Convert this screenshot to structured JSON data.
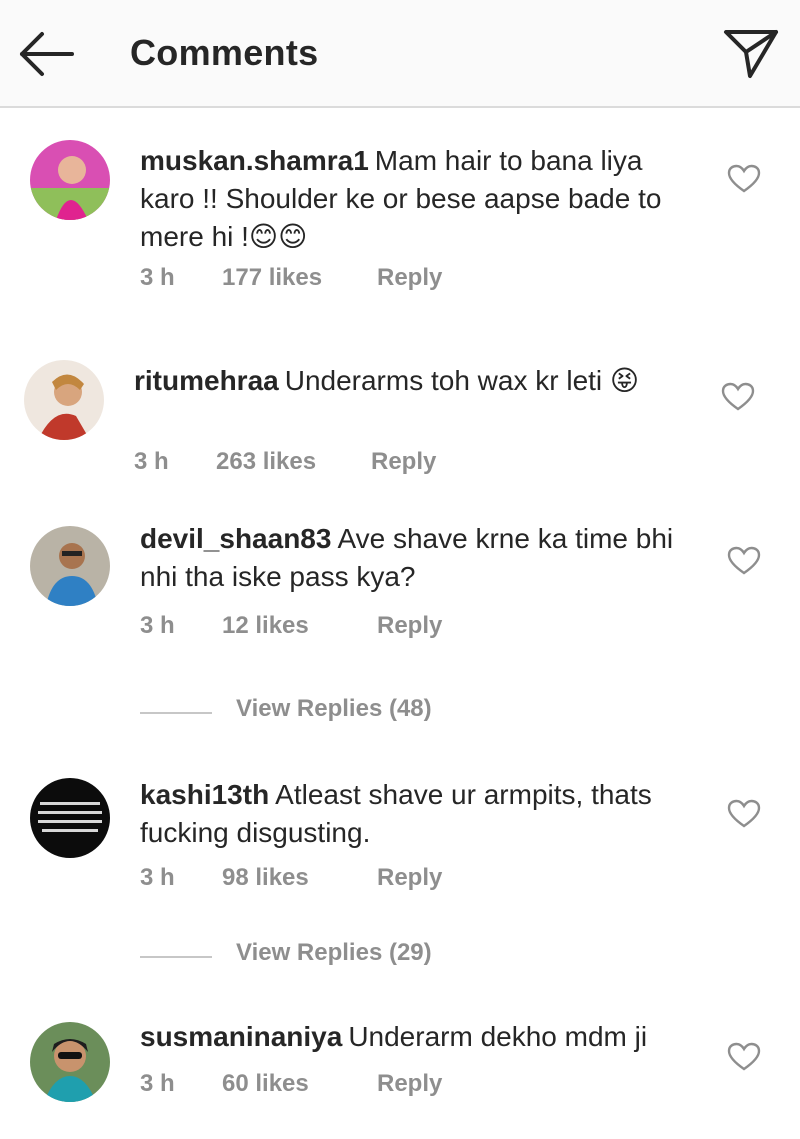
{
  "header": {
    "title": "Comments",
    "back_icon": "arrow-left-icon",
    "send_icon": "paper-plane-icon"
  },
  "comments": [
    {
      "username": "muskan.shamra1",
      "text": "Mam hair to bana liya karo !! Shoulder ke or bese aapse bade to mere hi !😊😊",
      "time": "3 h",
      "likes": "177 likes",
      "reply": "Reply"
    },
    {
      "username": "ritumehraa",
      "text": "Underarms toh wax kr leti 😝",
      "time": "3 h",
      "likes": "263 likes",
      "reply": "Reply"
    },
    {
      "username": "devil_shaan83",
      "text": "Ave shave krne ka time bhi nhi tha iske pass kya?",
      "time": "3 h",
      "likes": "12 likes",
      "reply": "Reply",
      "view_replies": "View Replies (48)"
    },
    {
      "username": "kashi13th",
      "text": "Atleast shave ur armpits, thats fucking disgusting.",
      "time": "3 h",
      "likes": "98 likes",
      "reply": "Reply",
      "view_replies": "View Replies (29)"
    },
    {
      "username": "susmaninaniya",
      "text": "Underarm dekho mdm ji",
      "time": "3 h",
      "likes": "60 likes",
      "reply": "Reply"
    }
  ],
  "colors": {
    "text": "#262626",
    "meta": "#8e8e8e",
    "header_bg": "#fafafa",
    "divider": "#dbdbdb"
  }
}
